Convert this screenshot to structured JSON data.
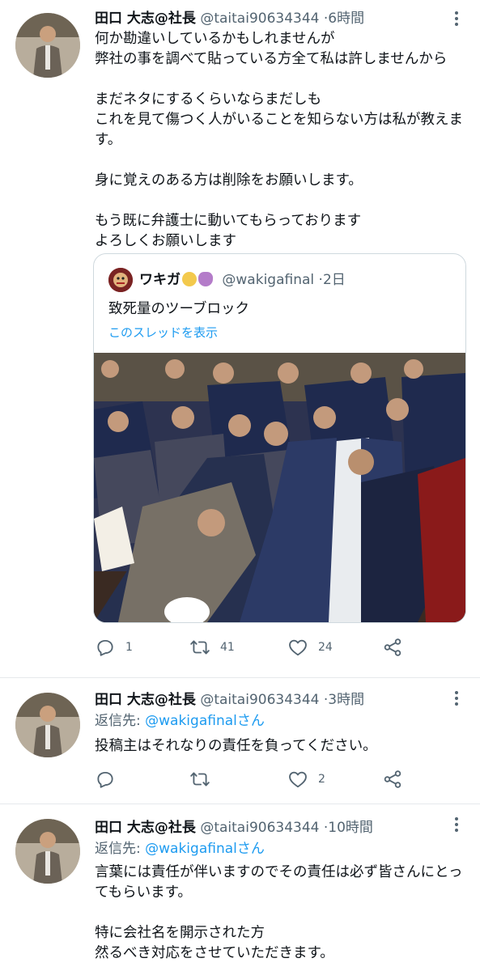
{
  "tweets": [
    {
      "name": "田口 大志@社長",
      "handle": "@taitai90634344",
      "dot": "·",
      "time": "6時間",
      "body": "何か勘違いしているかもしれませんが\n弊社の事を調べて貼っている方全て私は許しませんから\n\nまだネタにするくらいならまだしも\nこれを見て傷つく人がいることを知らない方は私が教えます。\n\n身に覚えのある方は削除をお願いします。\n\nもう既に弁護士に動いてもらっております\nよろしくお願いします",
      "quote": {
        "name": "ワキガ",
        "handle": "@wakigafinal",
        "dot": "·",
        "time": "2日",
        "text": "致死量のツーブロック",
        "show_thread": "このスレッドを表示"
      },
      "replies": "1",
      "retweets": "41",
      "likes": "24"
    },
    {
      "name": "田口 大志@社長",
      "handle": "@taitai90634344",
      "dot": "·",
      "time": "3時間",
      "reply_prefix": "返信先: ",
      "reply_to": "@wakigafinalさん",
      "body": "投稿主はそれなりの責任を負ってください。",
      "replies": "",
      "retweets": "",
      "likes": "2"
    },
    {
      "name": "田口 大志@社長",
      "handle": "@taitai90634344",
      "dot": "·",
      "time": "10時間",
      "reply_prefix": "返信先: ",
      "reply_to": "@wakigafinalさん",
      "body": "言葉には責任が伴いますのでその責任は必ず皆さんにとってもらいます。\n\n特に会社名を開示された方\n然るべき対応をさせていただきます。"
    }
  ],
  "icons": [
    "more-icon",
    "reply-icon",
    "retweet-icon",
    "like-icon",
    "share-icon"
  ],
  "colors": {
    "link": "#1d9bf0",
    "secondary": "#536471",
    "text": "#0f1419",
    "border": "#cfd9de"
  }
}
